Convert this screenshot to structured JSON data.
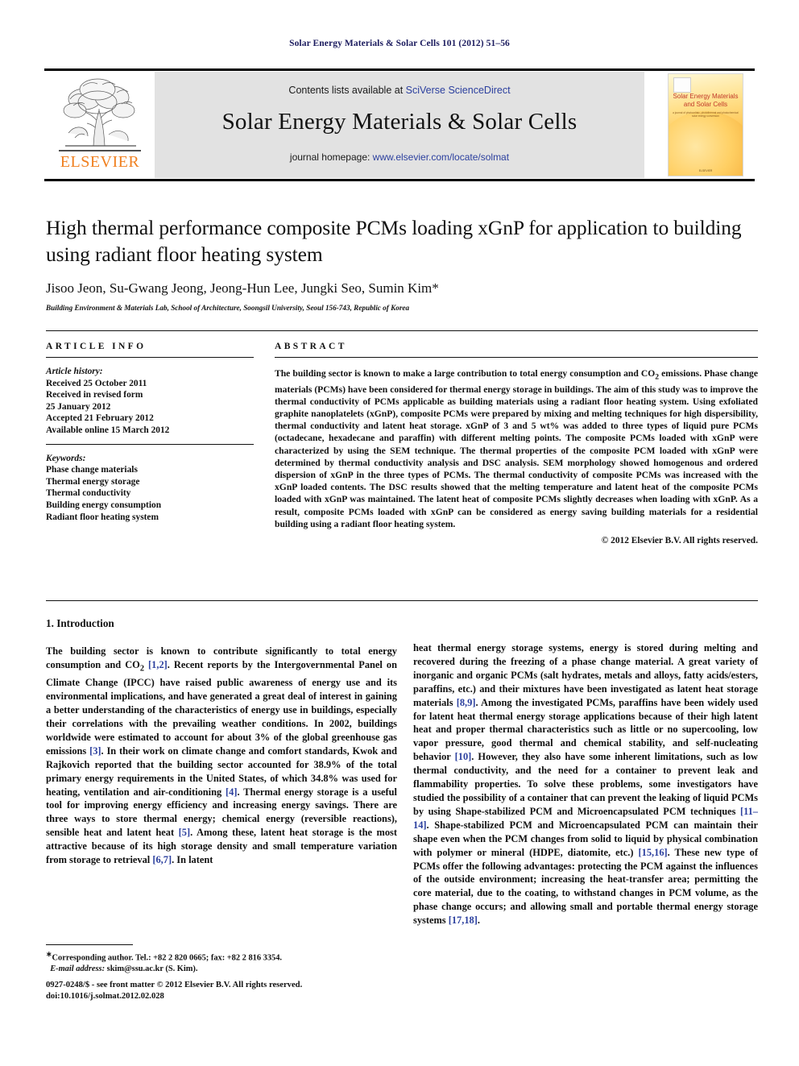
{
  "running_head": "Solar Energy Materials & Solar Cells 101 (2012) 51–56",
  "masthead": {
    "contents_prefix": "Contents lists available at ",
    "contents_link": "SciVerse ScienceDirect",
    "journal_title": "Solar Energy Materials & Solar Cells",
    "homepage_prefix": "journal homepage: ",
    "homepage_url": "www.elsevier.com/locate/solmat",
    "publisher_wordmark": "ELSEVIER",
    "publisher_color": "#f08020",
    "link_color": "#2b3f9e"
  },
  "cover": {
    "title_line1": "Solar Energy Materials",
    "title_line2": "and Solar Cells",
    "subtitle": "a journal of photovoltaic, photothermal and photochemical solar energy conversion",
    "footer": "ELSEVIER",
    "title_color": "#c0392b"
  },
  "article": {
    "title": "High thermal performance composite PCMs loading xGnP for application to building using radiant floor heating system",
    "authors": "Jisoo Jeon, Su-Gwang Jeong, Jeong-Hun Lee, Jungki Seo, Sumin Kim*",
    "affiliation": "Building Environment & Materials Lab, School of Architecture, Soongsil University, Seoul 156-743, Republic of Korea"
  },
  "article_info": {
    "label": "ARTICLE INFO",
    "history_label": "Article history:",
    "history": [
      "Received 25 October 2011",
      "Received in revised form",
      "25 January 2012",
      "Accepted 21 February 2012",
      "Available online 15 March 2012"
    ],
    "keywords_label": "Keywords:",
    "keywords": [
      "Phase change materials",
      "Thermal energy storage",
      "Thermal conductivity",
      "Building energy consumption",
      "Radiant floor heating system"
    ]
  },
  "abstract": {
    "label": "ABSTRACT",
    "text": "The building sector is known to make a large contribution to total energy consumption and CO2 emissions. Phase change materials (PCMs) have been considered for thermal energy storage in buildings. The aim of this study was to improve the thermal conductivity of PCMs applicable as building materials using a radiant floor heating system. Using exfoliated graphite nanoplatelets (xGnP), composite PCMs were prepared by mixing and melting techniques for high dispersibility, thermal conductivity and latent heat storage. xGnP of 3 and 5 wt% was added to three types of liquid pure PCMs (octadecane, hexadecane and paraffin) with different melting points. The composite PCMs loaded with xGnP were characterized by using the SEM technique. The thermal properties of the composite PCM loaded with xGnP were determined by thermal conductivity analysis and DSC analysis. SEM morphology showed homogenous and ordered dispersion of xGnP in the three types of PCMs. The thermal conductivity of composite PCMs was increased with the xGnP loaded contents. The DSC results showed that the melting temperature and latent heat of the composite PCMs loaded with xGnP was maintained. The latent heat of composite PCMs slightly decreases when loading with xGnP. As a result, composite PCMs loaded with xGnP can be considered as energy saving building materials for a residential building using a radiant floor heating system.",
    "copyright": "© 2012 Elsevier B.V. All rights reserved."
  },
  "body": {
    "section_heading": "1.  Introduction",
    "left_column": "The building sector is known to contribute significantly to total energy consumption and CO2 [1,2]. Recent reports by the Intergovernmental Panel on Climate Change (IPCC) have raised public awareness of energy use and its environmental implications, and have generated a great deal of interest in gaining a better understanding of the characteristics of energy use in buildings, especially their correlations with the prevailing weather conditions. In 2002, buildings worldwide were estimated to account for about 3% of the global greenhouse gas emissions [3]. In their work on climate change and comfort standards, Kwok and Rajkovich reported that the building sector accounted for 38.9% of the total primary energy requirements in the United States, of which 34.8% was used for heating, ventilation and air-conditioning [4]. Thermal energy storage is a useful tool for improving energy efficiency and increasing energy savings. There are three ways to store thermal energy; chemical energy (reversible reactions), sensible heat and latent heat [5]. Among these, latent heat storage is the most attractive because of its high storage density and small temperature variation from storage to retrieval [6,7]. In latent",
    "right_column": "heat thermal energy storage systems, energy is stored during melting and recovered during the freezing of a phase change material. A great variety of inorganic and organic PCMs (salt hydrates, metals and alloys, fatty acids/esters, paraffins, etc.) and their mixtures have been investigated as latent heat storage materials [8,9]. Among the investigated PCMs, paraffins have been widely used for latent heat thermal energy storage applications because of their high latent heat and proper thermal characteristics such as little or no supercooling, low vapor pressure, good thermal and chemical stability, and self-nucleating behavior [10]. However, they also have some inherent limitations, such as low thermal conductivity, and the need for a container to prevent leak and flammability properties. To solve these problems, some investigators have studied the possibility of a container that can prevent the leaking of liquid PCMs by using Shape-stabilized PCM and Microencapsulated PCM techniques [11–14]. Shape-stabilized PCM and Microencapsulated PCM can maintain their shape even when the PCM changes from solid to liquid by physical combination with polymer or mineral (HDPE, diatomite, etc.) [15,16]. These new type of PCMs offer the following advantages: protecting the PCM against the influences of the outside environment; increasing the heat-transfer area; permitting the core material, due to the coating, to withstand changes in PCM volume, as the phase change occurs; and allowing small and portable thermal energy storage systems [17,18]."
  },
  "footnote": {
    "corresponding": "Corresponding author. Tel.: +82 2 820 0665; fax: +82 2 816 3354.",
    "email_label": "E-mail address:",
    "email": "skim@ssu.ac.kr (S. Kim)."
  },
  "imprint": {
    "issn_line": "0927-0248/$ - see front matter © 2012 Elsevier B.V. All rights reserved.",
    "doi_line": "doi:10.1016/j.solmat.2012.02.028"
  }
}
